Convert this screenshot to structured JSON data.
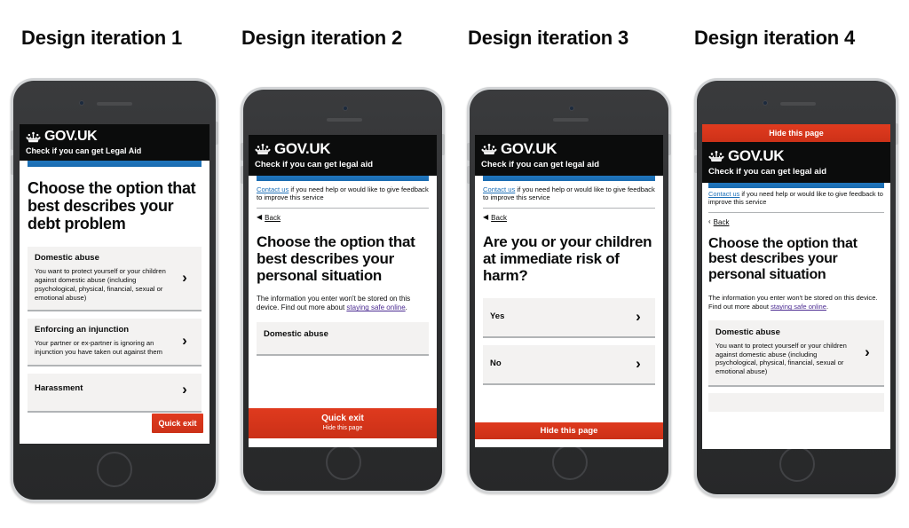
{
  "page": {
    "background": "#ffffff",
    "accent_red": "#d4351c",
    "accent_blue": "#1d70b8",
    "header_black": "#0b0c0c",
    "card_grey": "#f3f2f1"
  },
  "columns": [
    {
      "title": "Design iteration 1"
    },
    {
      "title": "Design iteration 2"
    },
    {
      "title": "Design iteration 3"
    },
    {
      "title": "Design iteration 4"
    }
  ],
  "phone1": {
    "header": {
      "wordmark": "GOV.UK",
      "service_name": "Check if you can get Legal Aid",
      "crown_icon": "crown-icon"
    },
    "heading": "Choose the option that best describes your debt problem",
    "options": [
      {
        "title": "Domestic abuse",
        "description": "You want to protect yourself or your children against domestic abuse (including psychological, physical, financial, sexual or emotional abuse)",
        "chevron": "chevron-right-icon"
      },
      {
        "title": "Enforcing an injunction",
        "description": "Your partner or ex-partner is ignoring an injunction you have taken out against them",
        "chevron": "chevron-right-icon"
      },
      {
        "title": "Harassment",
        "description": "",
        "chevron": "chevron-right-icon"
      }
    ],
    "quick_exit": "Quick exit"
  },
  "phone2": {
    "header": {
      "wordmark": "GOV.UK",
      "service_name": "Check if you can get legal aid",
      "crown_icon": "crown-icon"
    },
    "contact": {
      "link": "Contact us",
      "rest": " if you need help or would like to give feedback to improve this service"
    },
    "back_label": "Back",
    "heading": "Choose the option that best describes your personal situation",
    "intro": {
      "lead": "The information you enter won't be stored on this device. Find out more about ",
      "link": "staying safe online",
      "tail": "."
    },
    "options": [
      {
        "title": "Domestic abuse",
        "description": "",
        "chevron": "chevron-right-icon"
      }
    ],
    "exit_bar": {
      "main": "Quick exit",
      "sub": "Hide this page"
    }
  },
  "phone3": {
    "header": {
      "wordmark": "GOV.UK",
      "service_name": "Check if you can get legal aid",
      "crown_icon": "crown-icon"
    },
    "contact": {
      "link": "Contact us",
      "rest": " if you need help or would like to give feedback to improve this service"
    },
    "back_label": "Back",
    "heading": "Are you or your children at immediate risk of harm?",
    "options": [
      {
        "title": "Yes",
        "chevron": "chevron-right-icon"
      },
      {
        "title": "No",
        "chevron": "chevron-right-icon"
      }
    ],
    "exit_bar": {
      "main": "Hide this page"
    }
  },
  "phone4": {
    "top_bar": "Hide this page",
    "header": {
      "wordmark": "GOV.UK",
      "service_name": "Check if you can get legal aid",
      "crown_icon": "crown-icon"
    },
    "contact": {
      "link": "Contact us",
      "rest": " if you need help or would like to give feedback to improve this service"
    },
    "back_label": "Back",
    "heading": "Choose the option that best describes your personal situation",
    "intro": {
      "lead": "The information you enter won't be stored on this device. Find out more about ",
      "link": "staying safe online",
      "tail": "."
    },
    "options": [
      {
        "title": "Domestic abuse",
        "description": "You want to protect yourself or your children against domestic abuse (including psychological, physical, financial, sexual or emotional abuse)",
        "chevron": "chevron-right-icon"
      }
    ]
  }
}
